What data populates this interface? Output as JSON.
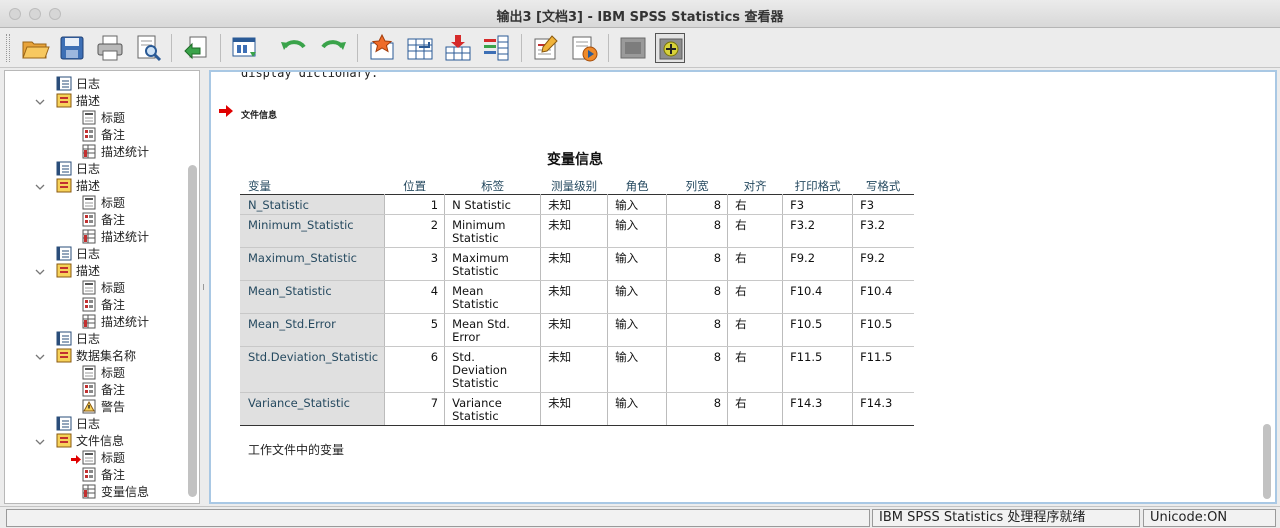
{
  "window": {
    "title": "输出3 [文档3] - IBM SPSS Statistics 查看器"
  },
  "toolbar": {
    "buttons": [
      {
        "name": "open-icon"
      },
      {
        "name": "save-icon"
      },
      {
        "name": "print-icon"
      },
      {
        "name": "print-preview-icon"
      },
      {
        "name": "export-icon"
      },
      {
        "name": "recall-dialog-icon"
      },
      {
        "name": "undo-icon"
      },
      {
        "name": "redo-icon"
      },
      {
        "name": "goto-data-icon"
      },
      {
        "name": "goto-case-icon"
      },
      {
        "name": "goto-variable-icon"
      },
      {
        "name": "variables-icon"
      },
      {
        "name": "insert-title-icon"
      },
      {
        "name": "insert-text-icon"
      },
      {
        "name": "hide-icon"
      },
      {
        "name": "expand-icon"
      }
    ]
  },
  "outline": {
    "items": [
      {
        "label": "日志",
        "icon": "log-icon"
      },
      {
        "label": "描述",
        "icon": "output-group-icon",
        "twisty": true
      },
      {
        "label": "标题",
        "icon": "title-icon"
      },
      {
        "label": "备注",
        "icon": "notes-icon"
      },
      {
        "label": "描述统计",
        "icon": "table-icon"
      },
      {
        "label": "日志",
        "icon": "log-icon"
      },
      {
        "label": "描述",
        "icon": "output-group-icon",
        "twisty": true
      },
      {
        "label": "标题",
        "icon": "title-icon"
      },
      {
        "label": "备注",
        "icon": "notes-icon"
      },
      {
        "label": "描述统计",
        "icon": "table-icon"
      },
      {
        "label": "日志",
        "icon": "log-icon"
      },
      {
        "label": "描述",
        "icon": "output-group-icon",
        "twisty": true
      },
      {
        "label": "标题",
        "icon": "title-icon"
      },
      {
        "label": "备注",
        "icon": "notes-icon"
      },
      {
        "label": "描述统计",
        "icon": "table-icon"
      },
      {
        "label": "日志",
        "icon": "log-icon"
      },
      {
        "label": "数据集名称",
        "icon": "output-group-icon",
        "twisty": true
      },
      {
        "label": "标题",
        "icon": "title-icon"
      },
      {
        "label": "备注",
        "icon": "notes-icon"
      },
      {
        "label": "警告",
        "icon": "warning-icon"
      },
      {
        "label": "日志",
        "icon": "log-icon"
      },
      {
        "label": "文件信息",
        "icon": "output-group-icon",
        "twisty": true
      },
      {
        "label": "标题",
        "icon": "title-icon",
        "current": true
      },
      {
        "label": "备注",
        "icon": "notes-icon"
      },
      {
        "label": "变量信息",
        "icon": "table-icon"
      }
    ]
  },
  "content": {
    "code_line": "display dictionary.",
    "section_title": "文件信息",
    "table": {
      "title": "变量信息",
      "headers": [
        "变量",
        "位置",
        "标签",
        "测量级别",
        "角色",
        "列宽",
        "对齐",
        "打印格式",
        "写格式"
      ],
      "rows": [
        [
          "N_Statistic",
          "1",
          "N Statistic",
          "未知",
          "输入",
          "8",
          "右",
          "F3",
          "F3"
        ],
        [
          "Minimum_Statistic",
          "2",
          "Minimum\nStatistic",
          "未知",
          "输入",
          "8",
          "右",
          "F3.2",
          "F3.2"
        ],
        [
          "Maximum_Statistic",
          "3",
          "Maximum\nStatistic",
          "未知",
          "输入",
          "8",
          "右",
          "F9.2",
          "F9.2"
        ],
        [
          "Mean_Statistic",
          "4",
          "Mean\nStatistic",
          "未知",
          "输入",
          "8",
          "右",
          "F10.4",
          "F10.4"
        ],
        [
          "Mean_Std.Error",
          "5",
          "Mean Std.\nError",
          "未知",
          "输入",
          "8",
          "右",
          "F10.5",
          "F10.5"
        ],
        [
          "Std.Deviation_Statistic",
          "6",
          "Std.\nDeviation\nStatistic",
          "未知",
          "输入",
          "8",
          "右",
          "F11.5",
          "F11.5"
        ],
        [
          "Variance_Statistic",
          "7",
          "Variance\nStatistic",
          "未知",
          "输入",
          "8",
          "右",
          "F14.3",
          "F14.3"
        ]
      ],
      "footnote": "工作文件中的变量"
    }
  },
  "status": {
    "processor": "IBM SPSS Statistics 处理程序就绪",
    "unicode": "Unicode:ON"
  },
  "colors": {
    "header_text": "#264a60",
    "row_label_bg": "#e0e0e0",
    "content_border": "#a9c8e4",
    "current_arrow": "#e00000"
  }
}
